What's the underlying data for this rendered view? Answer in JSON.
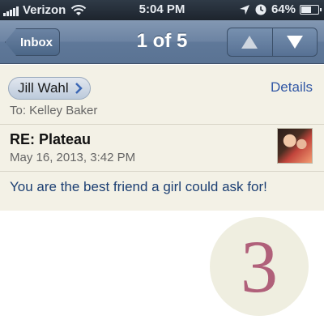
{
  "status_bar": {
    "carrier": "Verizon",
    "time": "5:04 PM",
    "battery_percent": "64%",
    "battery_level": 0.64,
    "icons": [
      "signal-icon",
      "wifi-icon",
      "location-icon",
      "clock-icon",
      "battery-icon"
    ]
  },
  "nav": {
    "back_label": "Inbox",
    "title": "1 of 5",
    "icons": [
      "up-arrow-icon",
      "down-arrow-icon"
    ]
  },
  "message": {
    "sender": "Jill Wahl",
    "details_label": "Details",
    "to_line": "To: Kelley Baker",
    "subject": "RE: Plateau",
    "date": "May 16, 2013, 3:42 PM",
    "body": "You are the best friend a girl could ask for!"
  },
  "overlay": {
    "number": "3",
    "number_color": "#b0607a",
    "circle_color": "#efeee0"
  },
  "colors": {
    "nav_bar": "#6d84a3",
    "link": "#3157a5",
    "body_text": "#1c3f73",
    "header_bg": "#f3f1e6"
  }
}
